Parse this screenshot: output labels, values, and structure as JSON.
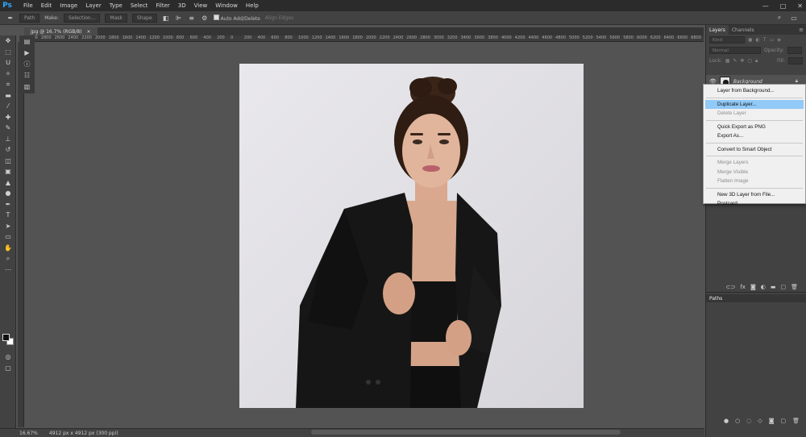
{
  "app": {
    "logo": "Ps"
  },
  "menu": [
    "File",
    "Edit",
    "Image",
    "Layer",
    "Type",
    "Select",
    "Filter",
    "3D",
    "View",
    "Window",
    "Help"
  ],
  "window_controls": [
    "—",
    "□",
    "✕"
  ],
  "options_bar": {
    "mode": "Path",
    "make_label": "Make:",
    "selection": "Selection...",
    "mask": "Mask",
    "shape": "Shape",
    "auto_add": "Auto Add/Delete",
    "align_edges": "Align Edges"
  },
  "document": {
    "tab_title": "jpg @ 16.7% (RGB/8)",
    "close": "×",
    "ruler_labels": [
      "3000",
      "2800",
      "2600",
      "2400",
      "2200",
      "2000",
      "1800",
      "1600",
      "1400",
      "1200",
      "1000",
      "800",
      "600",
      "400",
      "200",
      "0",
      "200",
      "400",
      "600",
      "800",
      "1000",
      "1200",
      "1400",
      "1600",
      "1800",
      "2000",
      "2200",
      "2400",
      "2600",
      "2800",
      "3000",
      "3200",
      "3400",
      "3600",
      "3800",
      "4000",
      "4200",
      "4400",
      "4600",
      "4800",
      "5000",
      "5200",
      "5400",
      "5600",
      "5800",
      "6000",
      "6200",
      "6400",
      "6600",
      "6800"
    ]
  },
  "status": {
    "zoom": "16.67%",
    "size": "4912 px x 4912 px (300 ppi)"
  },
  "layers_panel": {
    "tabs": [
      "Layers",
      "Channels"
    ],
    "kind_placeholder": "Kind",
    "blend_mode": "Normal",
    "opacity_label": "Opacity:",
    "lock_label": "Lock:",
    "fill_label": "Fill:",
    "layer_name": "Background"
  },
  "paths_panel": {
    "title": "Paths"
  },
  "context_menu": {
    "items": [
      {
        "label": "Layer from Background...",
        "enabled": true
      },
      {
        "label": "Duplicate Layer...",
        "enabled": true,
        "highlighted": true
      },
      {
        "label": "Delete Layer",
        "enabled": false
      },
      {
        "label": "Quick Export as PNG",
        "enabled": true
      },
      {
        "label": "Export As...",
        "enabled": true
      },
      {
        "label": "Convert to Smart Object",
        "enabled": true
      },
      {
        "label": "Merge Layers",
        "enabled": false
      },
      {
        "label": "Merge Visible",
        "enabled": false
      },
      {
        "label": "Flatten Image",
        "enabled": false
      },
      {
        "label": "New 3D Layer from File...",
        "enabled": true
      },
      {
        "label": "Postcard",
        "enabled": true
      }
    ]
  },
  "colors": {
    "accent": "#31a8ff",
    "highlight": "#91c9f7",
    "canvas_bg": "#535353"
  }
}
